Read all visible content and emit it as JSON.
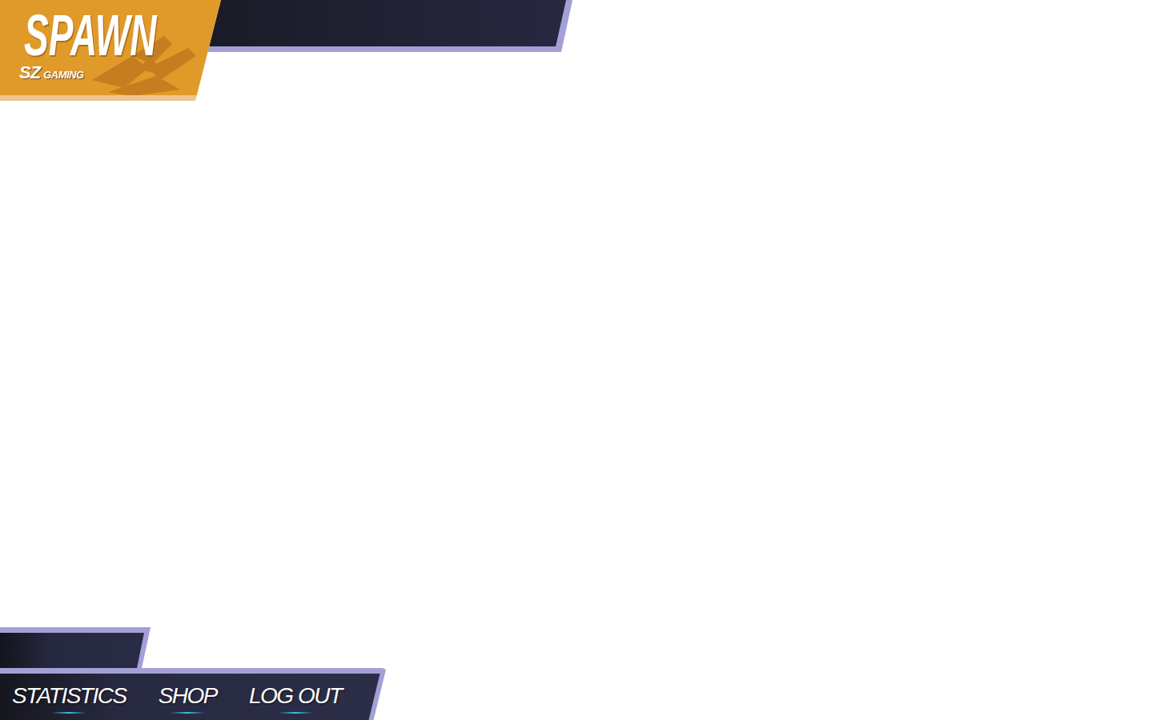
{
  "logo": {
    "title": "SPAWN",
    "tag": "SZ",
    "label": "GAMING"
  },
  "nav": [
    {
      "label": "STATISTICS"
    },
    {
      "label": "SHOP"
    },
    {
      "label": "LOG OUT"
    }
  ]
}
